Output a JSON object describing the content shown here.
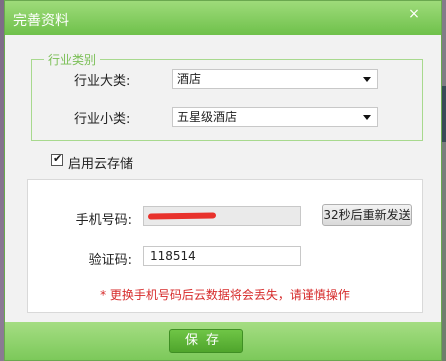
{
  "dialog": {
    "title": "完善资料",
    "close_glyph": "×"
  },
  "industry": {
    "legend": "行业类别",
    "major_label": "行业大类:",
    "major_value": "酒店",
    "minor_label": "行业小类:",
    "minor_value": "五星级酒店"
  },
  "cloud": {
    "label": "启用云存储",
    "checked": true,
    "check_glyph": "✔"
  },
  "verify": {
    "phone_label": "手机号码:",
    "resend_label": "32秒后重新发送",
    "code_label": "验证码:",
    "code_value": "118514",
    "warning": "* 更换手机号码后云数据将会丢失，请谨慎操作"
  },
  "footer": {
    "save_label": "保存"
  },
  "colors": {
    "accent_green": "#6fc14b",
    "warning_red": "#d62a2a",
    "redaction": "#e8322c"
  }
}
